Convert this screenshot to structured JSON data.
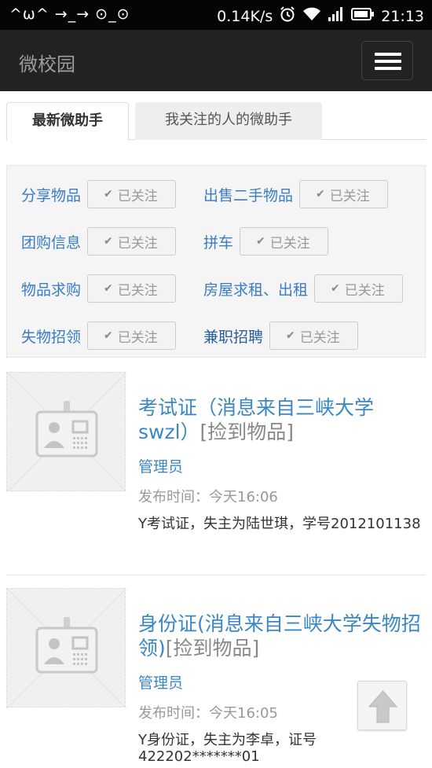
{
  "status_bar": {
    "left_text": "^ω^ →_→ ⊙_⊙",
    "network_speed": "0.14K/s",
    "time": "21:13",
    "alarm_icon": "alarm-icon",
    "wifi_icon": "wifi-icon",
    "signal_icon": "signal-icon",
    "battery_icon": "battery-icon"
  },
  "navbar": {
    "brand": "微校园",
    "menu_icon": "hamburger-menu-icon"
  },
  "tabs": [
    {
      "label": "最新微助手",
      "active": true
    },
    {
      "label": "我关注的人的微助手",
      "active": false
    }
  ],
  "categories": [
    {
      "name": "分享物品",
      "status": "已关注"
    },
    {
      "name": "出售二手物品",
      "status": "已关注"
    },
    {
      "name": "团购信息",
      "status": "已关注"
    },
    {
      "name": "拼车",
      "status": "已关注"
    },
    {
      "name": "物品求购",
      "status": "已关注"
    },
    {
      "name": "房屋求租、出租",
      "status": "已关注"
    },
    {
      "name": "失物招领",
      "status": "已关注"
    },
    {
      "name": "兼职招聘",
      "status": "已关注"
    }
  ],
  "posts": [
    {
      "title": "考试证（消息来自三峡大学swzl）",
      "tag": "[捡到物品]",
      "author": "管理员",
      "time": "发布时间：今天16:06",
      "desc": "Y考试证，失主为陆世琪，学号2012101138"
    },
    {
      "title": "身份证(消息来自三峡大学失物招领)",
      "tag": "[捡到物品]",
      "author": "管理员",
      "time": "发布时间：今天16:05",
      "desc": "Y身份证，失主为李卓，证号422202*******01"
    }
  ],
  "back_to_top_icon": "arrow-up-icon",
  "colors": {
    "navbar_bg": "#222222",
    "link_blue": "#3a87c8",
    "category_panel_bg": "#f5f5f5"
  }
}
